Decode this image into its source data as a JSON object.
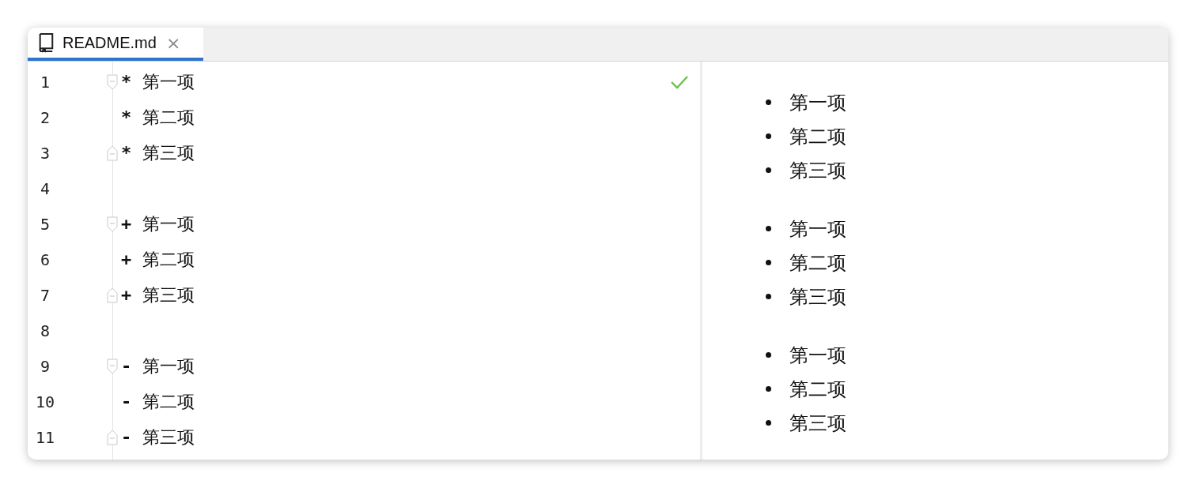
{
  "tab": {
    "title": "README.md",
    "close": "×",
    "selected": true
  },
  "editor": {
    "lines": [
      {
        "kind": "fold-start",
        "number": "1",
        "marker": "*",
        "text": "第一项"
      },
      {
        "kind": "plain",
        "number": "2",
        "marker": "*",
        "text": "第二项"
      },
      {
        "kind": "fold-end",
        "number": "3",
        "marker": "*",
        "text": "第三项"
      },
      {
        "kind": "plain",
        "number": "4"
      },
      {
        "kind": "fold-start",
        "number": "5",
        "marker": "+",
        "text": "第一项"
      },
      {
        "kind": "plain",
        "number": "6",
        "marker": "+",
        "text": "第二项"
      },
      {
        "kind": "fold-end",
        "number": "7",
        "marker": "+",
        "text": "第三项"
      },
      {
        "kind": "plain",
        "number": "8"
      },
      {
        "kind": "fold-start",
        "number": "9",
        "marker": "-",
        "text": "第一项"
      },
      {
        "kind": "plain",
        "number": "10",
        "marker": "-",
        "text": "第二项"
      },
      {
        "kind": "fold-end",
        "number": "11",
        "marker": "-",
        "text": "第三项"
      }
    ]
  },
  "preview": {
    "lists": [
      {
        "items": [
          "第一项",
          "第二项",
          "第三项"
        ]
      },
      {
        "items": [
          "第一项",
          "第二项",
          "第三项"
        ]
      },
      {
        "items": [
          "第一项",
          "第二项",
          "第三项"
        ]
      }
    ]
  }
}
